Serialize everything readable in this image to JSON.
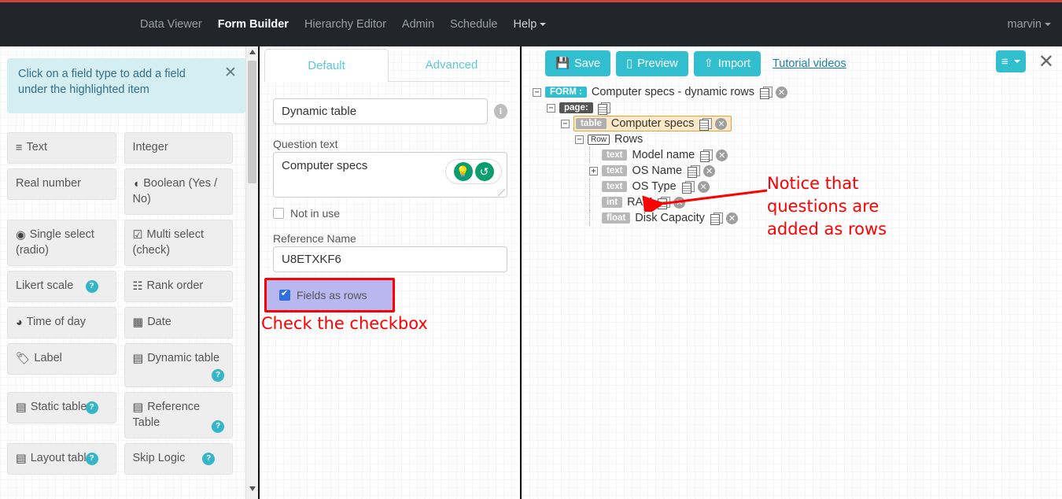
{
  "navbar": {
    "items": [
      {
        "label": "Data Viewer",
        "active": false
      },
      {
        "label": "Form Builder",
        "active": true
      },
      {
        "label": "Hierarchy Editor",
        "active": false
      },
      {
        "label": "Admin",
        "active": false
      },
      {
        "label": "Schedule",
        "active": false
      },
      {
        "label": "Help",
        "active": false,
        "caret": true
      }
    ],
    "user": "marvin"
  },
  "left": {
    "notice": "Click on a field type to add a field under the highlighted item",
    "notice_close": "✕",
    "fields": [
      {
        "label": "Text",
        "icon": "≡",
        "help": false,
        "tall": false
      },
      {
        "label": "Integer",
        "icon": "",
        "help": false,
        "tall": false
      },
      {
        "label": "Real number",
        "icon": "",
        "help": false,
        "tall": false
      },
      {
        "label": "Boolean (Yes / No)",
        "icon": "◖",
        "help": false,
        "tall": true
      },
      {
        "label": "Single select (radio)",
        "icon": "◉",
        "help": false,
        "tall": true
      },
      {
        "label": "Multi select (check)",
        "icon": "☑",
        "help": false,
        "tall": true
      },
      {
        "label": "Likert scale",
        "icon": "",
        "help": "right",
        "tall": false
      },
      {
        "label": "Rank order",
        "icon": "☷",
        "help": false,
        "tall": false
      },
      {
        "label": "Time of day",
        "icon": "◕",
        "help": false,
        "tall": false
      },
      {
        "label": "Date",
        "icon": "▦",
        "help": false,
        "tall": false
      },
      {
        "label": "Label",
        "icon": "🏷",
        "help": false,
        "tall": false
      },
      {
        "label": "Dynamic table",
        "icon": "▤",
        "help": "corner",
        "tall": true
      },
      {
        "label": "Static table",
        "icon": "▤",
        "help": "right",
        "tall": false
      },
      {
        "label": "Reference Table",
        "icon": "▤",
        "help": "corner",
        "tall": true
      },
      {
        "label": "Layout table",
        "icon": "▤",
        "help": "right",
        "tall": false
      },
      {
        "label": "Skip Logic",
        "icon": "",
        "help": "right",
        "tall": false
      }
    ],
    "help_badge": "?"
  },
  "middle": {
    "tabs": [
      {
        "label": "Default",
        "active": true
      },
      {
        "label": "Advanced",
        "active": false
      }
    ],
    "field_type_value": "Dynamic table",
    "info_icon": "i",
    "question_label": "Question text",
    "question_value": "Computer specs",
    "question_tools": {
      "hint": "💡",
      "reset": "↺"
    },
    "not_in_use_label": "Not in use",
    "not_in_use_checked": false,
    "reference_label": "Reference Name",
    "reference_value": "U8ETXKF6",
    "fields_as_rows_label": "Fields as rows",
    "fields_as_rows_checked": true,
    "annotation": "Check the checkbox"
  },
  "right": {
    "toolbar": {
      "save": "Save",
      "save_icon": "💾",
      "preview": "Preview",
      "preview_icon": "▯",
      "import": "Import",
      "import_icon": "⇧",
      "tutorial": "Tutorial videos"
    },
    "menu_icon": "≡",
    "close_icon": "✕",
    "annotation": "Notice that questions are added as rows",
    "tree": [
      {
        "indent": 0,
        "toggle": "−",
        "tag": "FORM :",
        "tagclass": "form",
        "name": "Computer specs - dynamic rows",
        "copy": true,
        "del": true,
        "highlight": false
      },
      {
        "indent": 1,
        "toggle": "−",
        "tag": "page:",
        "tagclass": "page",
        "name": "",
        "copy": true,
        "del": false,
        "highlight": false
      },
      {
        "indent": 2,
        "toggle": "−",
        "tag": "table",
        "tagclass": "table",
        "name": "Computer specs",
        "copy": true,
        "del": true,
        "highlight": true
      },
      {
        "indent": 3,
        "toggle": "−",
        "tag": "Row",
        "tagclass": "rowtag",
        "name": "Rows",
        "copy": false,
        "del": false,
        "highlight": false
      },
      {
        "indent": 4,
        "toggle": "",
        "tag": "text",
        "tagclass": "type",
        "name": "Model name",
        "copy": true,
        "del": true,
        "highlight": false
      },
      {
        "indent": 4,
        "toggle": "+",
        "tag": "text",
        "tagclass": "type",
        "name": "OS Name",
        "copy": true,
        "del": true,
        "highlight": false
      },
      {
        "indent": 4,
        "toggle": "",
        "tag": "text",
        "tagclass": "type",
        "name": "OS Type",
        "copy": true,
        "del": true,
        "highlight": false
      },
      {
        "indent": 4,
        "toggle": "",
        "tag": "int",
        "tagclass": "type",
        "name": "RAM",
        "copy": true,
        "del": true,
        "highlight": false
      },
      {
        "indent": 4,
        "toggle": "",
        "tag": "float",
        "tagclass": "type",
        "name": "Disk Capacity",
        "copy": true,
        "del": true,
        "highlight": false
      }
    ]
  },
  "colors": {
    "accent": "#31bfd0",
    "navbar": "#22262b",
    "topstrip": "#c9453e",
    "annotation": "#ff0000",
    "highlight_row": "#fde8c8",
    "checkbox_highlight": "#b9b7f0"
  }
}
